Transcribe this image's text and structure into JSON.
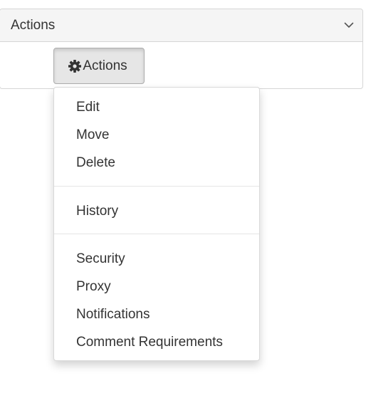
{
  "panel": {
    "title": "Actions",
    "toggle_icon": "chevron-down-icon"
  },
  "actions_button": {
    "label": "Actions",
    "icon": "gear-icon"
  },
  "menu": {
    "groups": [
      [
        {
          "label": "Edit"
        },
        {
          "label": "Move"
        },
        {
          "label": "Delete"
        }
      ],
      [
        {
          "label": "History"
        }
      ],
      [
        {
          "label": "Security"
        },
        {
          "label": "Proxy"
        },
        {
          "label": "Notifications"
        },
        {
          "label": "Comment Requirements"
        }
      ]
    ]
  },
  "colors": {
    "header_bg": "#f5f5f5",
    "border": "#d6d6d6",
    "button_active_bg": "#e6e6e6",
    "text": "#333333"
  }
}
